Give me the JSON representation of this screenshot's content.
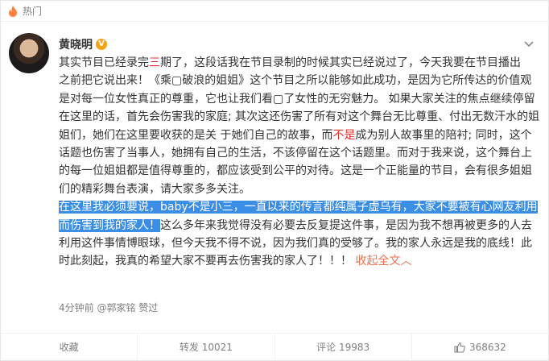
{
  "header": {
    "tab_label": "热门",
    "icon": "flame-icon"
  },
  "post": {
    "author": "黄晓明",
    "verified_badge": "V",
    "lines": [
      [
        {
          "t": "其实节目已经录完"
        },
        {
          "t": "三",
          "c": "red"
        },
        {
          "t": "期了，这段话我在节目录制的时候其实已经说过了，今天我要在节目播出"
        }
      ],
      [
        {
          "t": "之前把它说出来！《乘"
        },
        {
          "t": "▢"
        },
        {
          "t": "破浪的姐姐》这个节目之所以能够如此成功，是因为它所传达的价值观"
        }
      ],
      [
        {
          "t": "是对每一位女性真正的尊重，它也让我们看"
        },
        {
          "t": "▢"
        },
        {
          "t": "了女性的无穷魅力。 如果大家关注的焦点继续停留"
        }
      ],
      [
        {
          "t": "在这里的话，首先会伤害我的家庭; 其次这还伤害了所有对这个舞台无比尊重、付出无数汗水的姐"
        }
      ],
      [
        {
          "t": "姐们，她们在这里要收获的是关 于她们自己的故事，而"
        },
        {
          "t": "不是",
          "c": "red"
        },
        {
          "t": "成为别人故事里的陪衬; 同时，这个"
        }
      ],
      [
        {
          "t": "话题也伤害了当事人，她拥有自己的生活，不该停留在这个话题里。而对于我来说，这个舞台上"
        }
      ],
      [
        {
          "t": "的每一位姐姐都是值得尊重的，都应该受到公平的对待。这是一个正能量的节目，会有很多姐姐"
        }
      ],
      [
        {
          "t": "们的精彩舞台表演，请大家多多关注。"
        }
      ],
      [
        {
          "t": "在这里我必须要说，baby不是小三，一直以来的传言都纯属子虚乌有，大家不要被有心网友利用",
          "c": "sel"
        }
      ],
      [
        {
          "t": "而伤害到我的家人！",
          "c": "sel"
        },
        {
          "t": "这么多年来我觉得没有必要去反复提这件事，是因为我不想再被更多的人去"
        }
      ],
      [
        {
          "t": "利用这件事情博眼球，但今天我不得不说，因为我们真的受够了。我的家人永远是我的底线！此"
        }
      ],
      [
        {
          "t": "时此刻起，我真的希望大家不要再去伤害我的家人了！！！ "
        },
        {
          "t": "收起全文",
          "c": "link"
        },
        {
          "t": "︿",
          "c": "link"
        }
      ]
    ],
    "meta": "4分钟前 @郭家铭 赞过"
  },
  "actions": {
    "favorite": "收藏",
    "repost": "转发 10021",
    "comment": "评论 19983",
    "like": "368632"
  },
  "colors": {
    "accent": "#eb7350",
    "highlight": "#3a8ee6",
    "emphasis": "#e5302c",
    "badge": "#f7a21b"
  }
}
